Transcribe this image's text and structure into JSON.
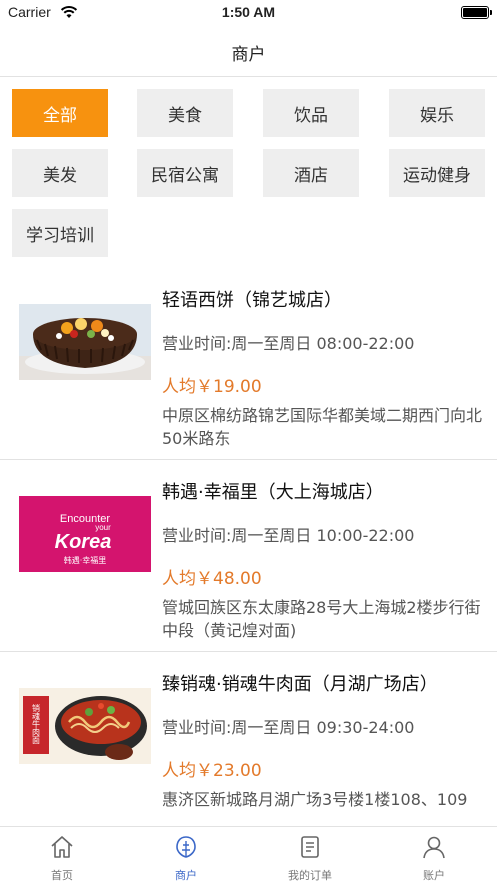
{
  "status_bar": {
    "carrier": "Carrier",
    "time": "1:50 AM"
  },
  "header": {
    "title": "商户"
  },
  "categories": [
    {
      "label": "全部",
      "active": true
    },
    {
      "label": "美食",
      "active": false
    },
    {
      "label": "饮品",
      "active": false
    },
    {
      "label": "娱乐",
      "active": false
    },
    {
      "label": "美发",
      "active": false
    },
    {
      "label": "民宿公寓",
      "active": false
    },
    {
      "label": "酒店",
      "active": false
    },
    {
      "label": "运动健身",
      "active": false
    },
    {
      "label": "学习培训",
      "active": false
    }
  ],
  "stores": [
    {
      "name": "轻语西饼（锦艺城店）",
      "hours": "营业时间:周一至周日 08:00-22:00",
      "price": "人均￥19.00",
      "address": "中原区棉纺路锦艺国际华都美域二期西门向北50米路东",
      "image": "chocolate-cake"
    },
    {
      "name": "韩遇·幸福里（大上海城店）",
      "hours": "营业时间:周一至周日 10:00-22:00",
      "price": "人均￥48.00",
      "address": "管城回族区东太康路28号大上海城2楼步行街中段（黄记煌对面)",
      "image": "encounter-your-korea-logo",
      "logo_text": {
        "line1": "Encounter",
        "line2": "your",
        "line3": "Korea",
        "line4": "韩遇·幸福里"
      }
    },
    {
      "name": "臻销魂·销魂牛肉面（月湖广场店）",
      "hours": "营业时间:周一至周日 09:30-24:00",
      "price": "人均￥23.00",
      "address": "惠济区新城路月湖广场3号楼1楼108、109",
      "image": "beef-noodle-bowl",
      "logo_text": {
        "banner": "销魂牛肉面"
      }
    }
  ],
  "tab_bar": {
    "items": [
      {
        "label": "首页",
        "icon": "home-icon",
        "active": false
      },
      {
        "label": "商户",
        "icon": "merchant-icon",
        "active": true
      },
      {
        "label": "我的订单",
        "icon": "orders-icon",
        "active": false
      },
      {
        "label": "账户",
        "icon": "account-icon",
        "active": false
      }
    ]
  },
  "colors": {
    "accent": "#f7920f",
    "price": "#e37a2b",
    "tab_active": "#3c68c8"
  }
}
